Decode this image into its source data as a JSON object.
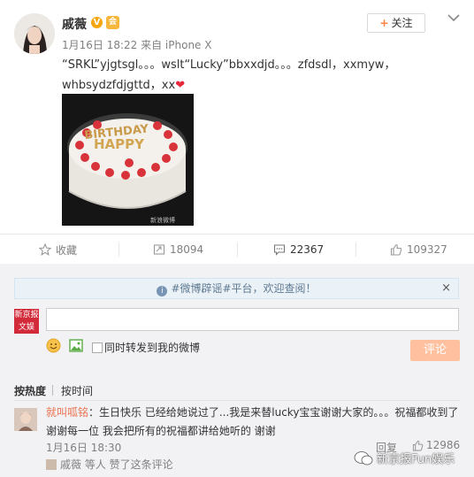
{
  "post": {
    "author": "戚薇",
    "verified_badge": "V",
    "vip_badge": "会",
    "meta": "1月16日 18:22 来自 iPhone X",
    "follow_label": "关注",
    "follow_plus": "+",
    "text_line1": "“SRKL”yjgtsgl。。。wslt“Lucky”bbxxdjd。。。zfdsdl，xxmyw，",
    "text_line2": "whbsydzfdjgttd，xx",
    "heart": "❤",
    "photo_cake_text": "HAPPY",
    "photo_watermark": "新浪微博"
  },
  "actions": {
    "favorite": "收藏",
    "repost": "18094",
    "comment": "22367",
    "like": "109327"
  },
  "comment_panel": {
    "notice": "#微博辟谣#平台，欢迎查阅！",
    "notice_close": "×",
    "mini_avatar_text": "新京报 文娱",
    "checkbox_label": "同时转发到我的微博",
    "submit_label": "评论",
    "sort_hot": "按热度",
    "sort_time": "按时间"
  },
  "comment": {
    "name": "就叫呱铭",
    "text": "：生日快乐 已经给她说过了...我是来替lucky宝宝谢谢大家的。。。祝福都收到了 谢谢每一位 我会把所有的祝福都讲给她听的 谢谢",
    "time": "1月16日 18:30",
    "reply": "回复",
    "likes": "12986",
    "sub": "戚薇 等人 赞了这条评论"
  },
  "watermark": "新京报Fun娱乐",
  "colors": {
    "orange": "#eb7350",
    "accent": "#ff8140",
    "panel": "#f2f2f5"
  }
}
